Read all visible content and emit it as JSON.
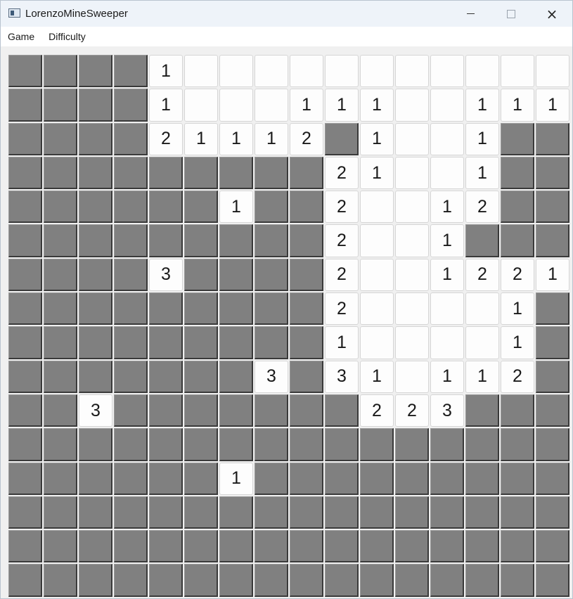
{
  "window": {
    "title": "LorenzoMineSweeper",
    "icon": "app-window-icon",
    "controls": {
      "minimize": "minimize-icon",
      "maximize": "maximize-icon",
      "close": "×"
    }
  },
  "menu": [
    {
      "id": "game",
      "label": "Game"
    },
    {
      "id": "difficulty",
      "label": "Difficulty"
    }
  ],
  "board": {
    "rows": 16,
    "cols": 16,
    "legend": {
      "#": "covered",
      ".": "opened-empty",
      "1-8": "opened-with-count"
    },
    "grid": [
      "####1...........",
      "####1...111..111",
      "####21112#1..1##",
      "#########21..1##",
      "######1##2..12##",
      "#########2..1###",
      "####3####2..1221",
      "#########2....1#",
      "#########1....1#",
      "#######3#31.112#",
      "##3#######223###",
      "################",
      "######1#########",
      "################",
      "################",
      "################"
    ]
  }
}
